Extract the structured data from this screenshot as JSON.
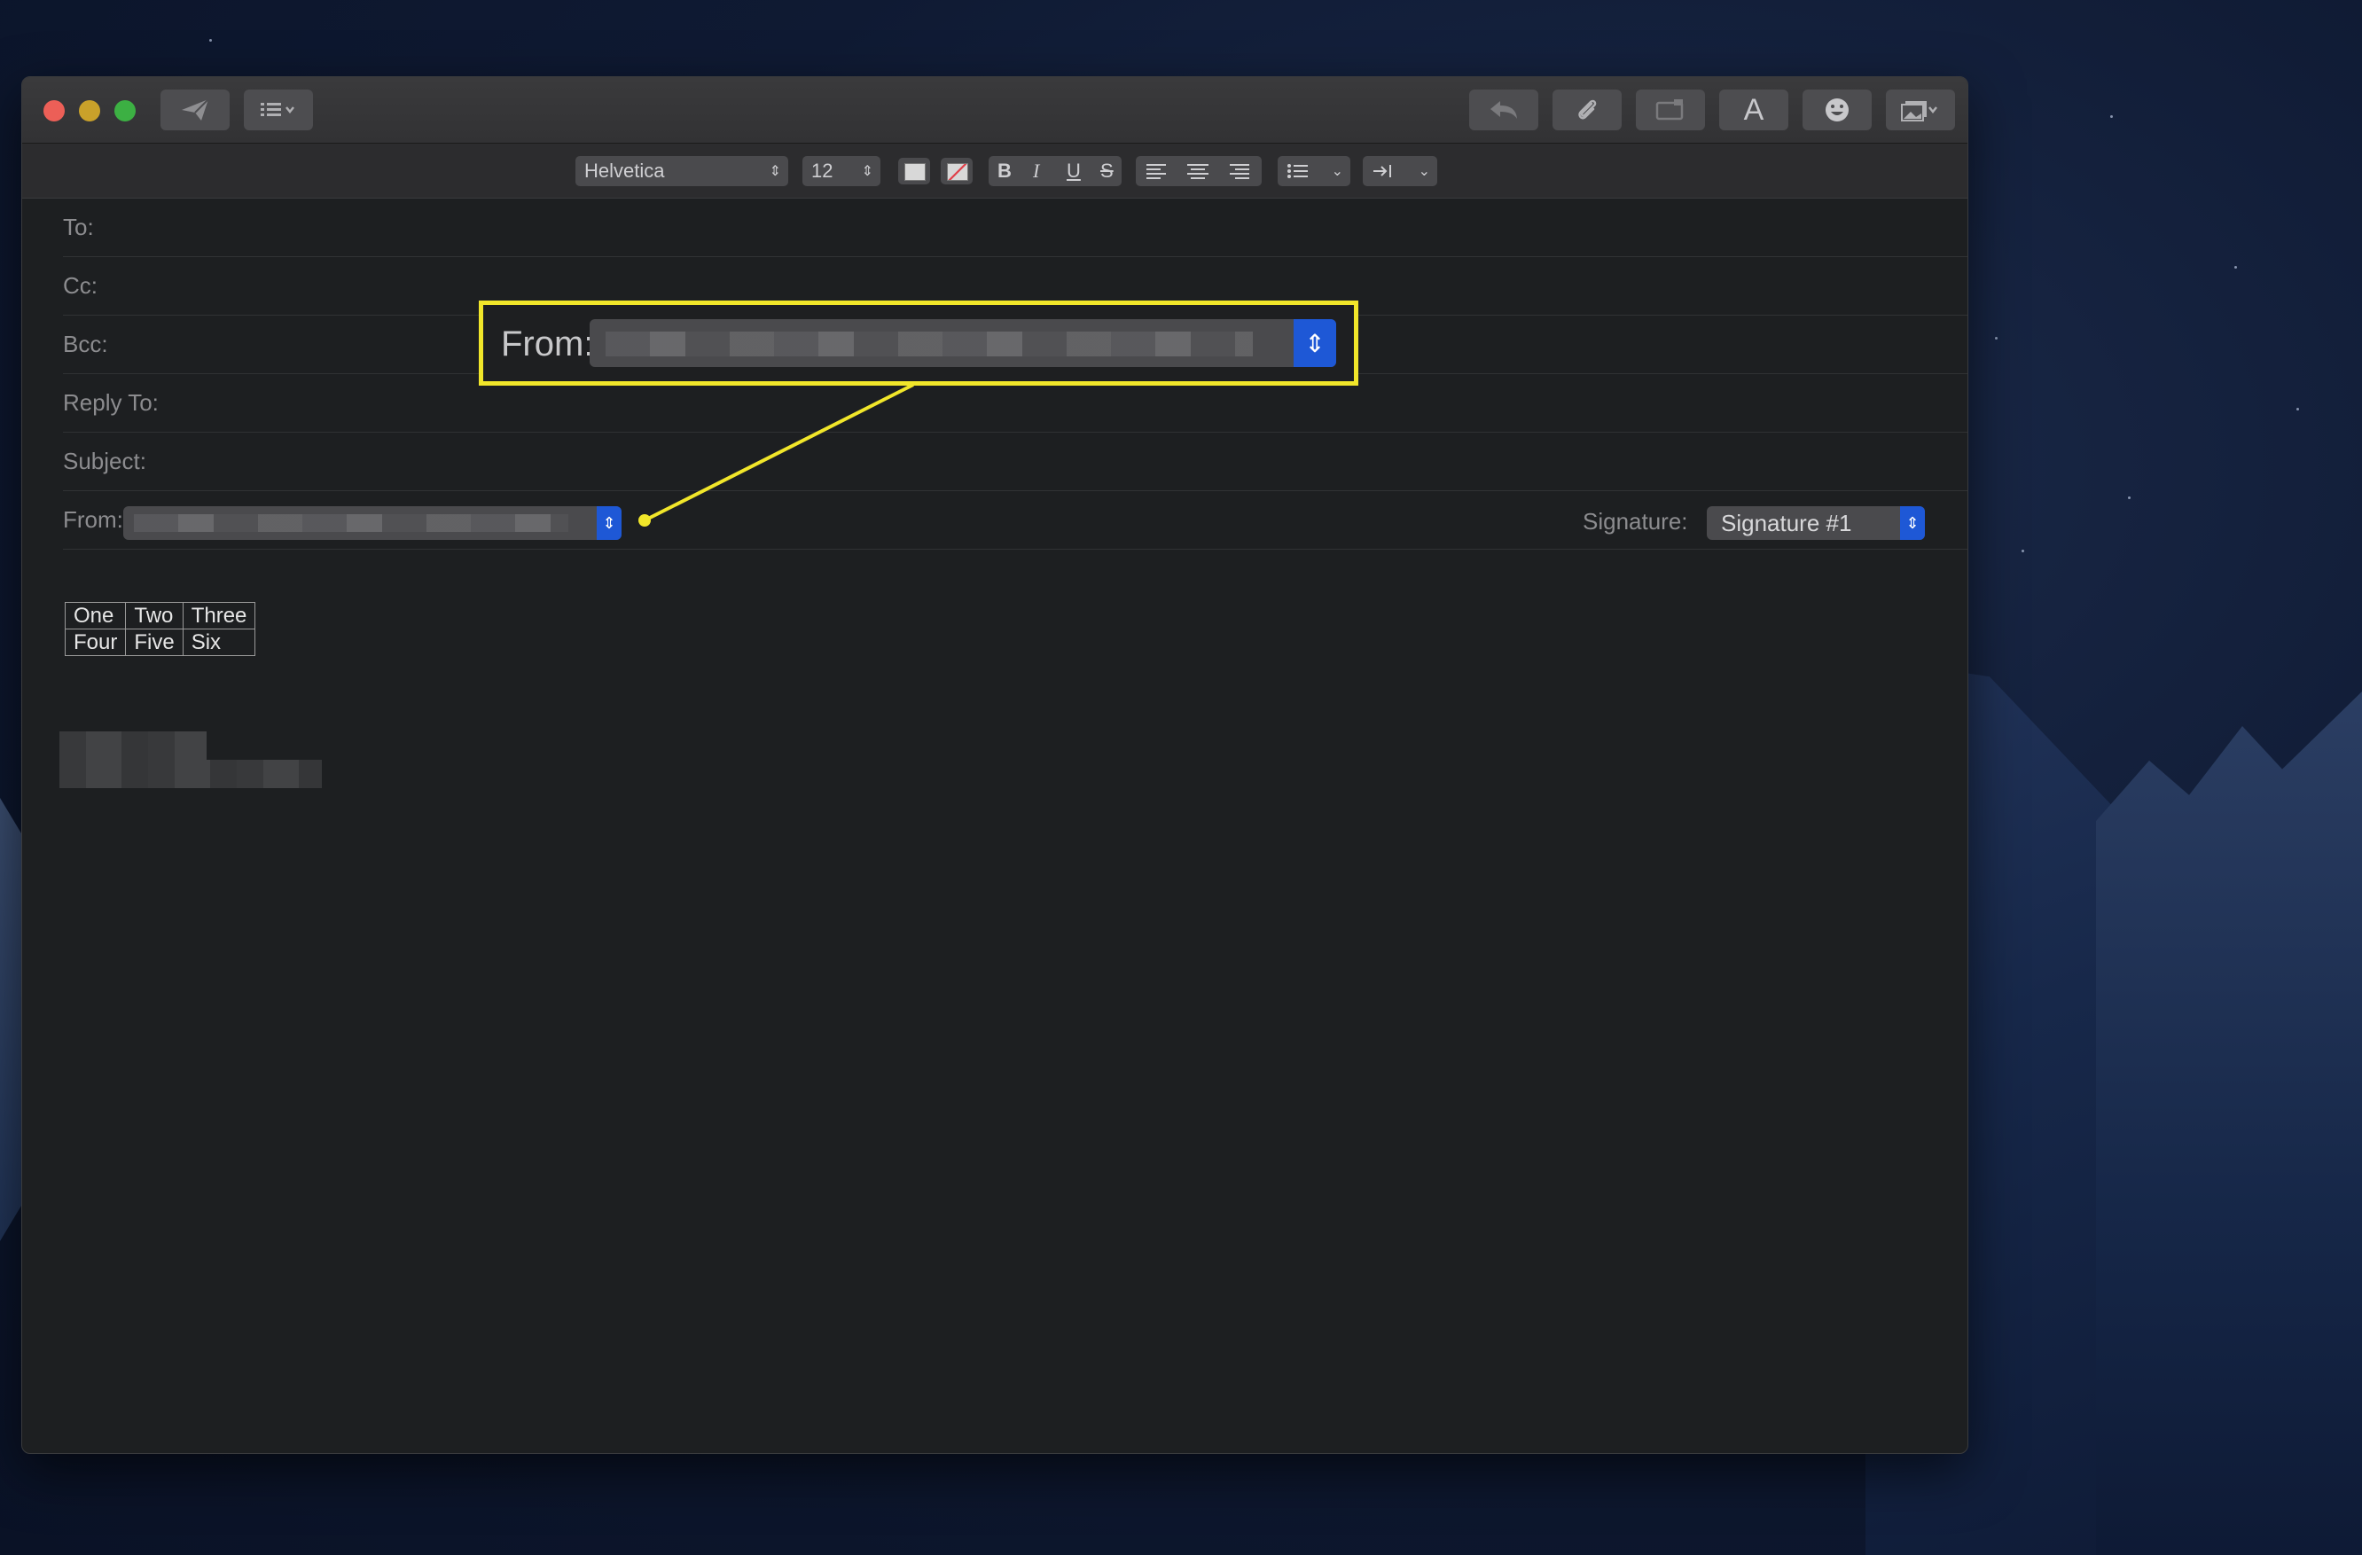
{
  "toolbar": {
    "send_icon": "paper-plane",
    "header_fields_icon": "list-menu",
    "reply_icon": "reply-arrow",
    "attach_icon": "paperclip",
    "photo_browser_icon": "photo-camera",
    "fonts_label": "A",
    "emoji_icon": "smiley",
    "media_icon": "photo-gallery"
  },
  "format_bar": {
    "font_name": "Helvetica",
    "font_size": "12",
    "bold": "B",
    "italic": "I",
    "underline": "U",
    "strikethrough": "S"
  },
  "header": {
    "to_label": "To:",
    "cc_label": "Cc:",
    "bcc_label": "Bcc:",
    "reply_to_label": "Reply To:",
    "subject_label": "Subject:",
    "from_label": "From:",
    "signature_label": "Signature:",
    "signature_value": "Signature #1"
  },
  "callout": {
    "from_label": "From:",
    "color": "#f1e62a"
  },
  "table": {
    "rows": [
      [
        "One",
        "Two",
        "Three"
      ],
      [
        "Four",
        "Five",
        "Six"
      ]
    ]
  },
  "colors": {
    "accent": "#1e58d6",
    "window_bg": "#1d1f21"
  }
}
